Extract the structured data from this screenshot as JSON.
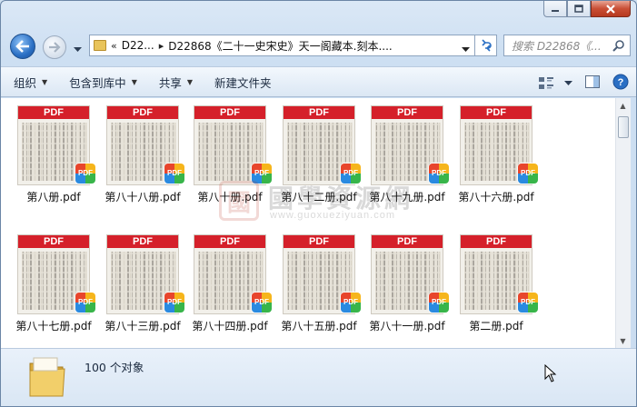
{
  "window": {
    "caption_buttons": [
      "minimize",
      "maximize",
      "close"
    ]
  },
  "address_bar": {
    "overflow_chevrons": "«",
    "crumbs": [
      "D22...",
      "D22868《二十一史宋史》天一阁藏本.刻本...."
    ],
    "separator": "▸"
  },
  "search": {
    "placeholder": "搜索 D22868《..."
  },
  "toolbar": {
    "organize": "组织",
    "include_in_library": "包含到库中",
    "share": "共享",
    "new_folder": "新建文件夹"
  },
  "files": [
    {
      "name": "第八册.pdf"
    },
    {
      "name": "第八十八册.pdf"
    },
    {
      "name": "第八十册.pdf"
    },
    {
      "name": "第八十二册.pdf"
    },
    {
      "name": "第八十九册.pdf"
    },
    {
      "name": "第八十六册.pdf"
    },
    {
      "name": "第八十七册.pdf"
    },
    {
      "name": "第八十三册.pdf"
    },
    {
      "name": "第八十四册.pdf"
    },
    {
      "name": "第八十五册.pdf"
    },
    {
      "name": "第八十一册.pdf"
    },
    {
      "name": "第二册.pdf"
    }
  ],
  "thumbnail_banner": "PDF",
  "badge_label": "PDF",
  "watermark": {
    "seal": "國",
    "title": "國學資源網",
    "url": "www.guoxueziyuan.com"
  },
  "status": {
    "item_count": "100 个对象"
  },
  "colors": {
    "pdf_banner": "#d5202a",
    "window_frame": "#cddff2",
    "close_button": "#c94f35"
  }
}
